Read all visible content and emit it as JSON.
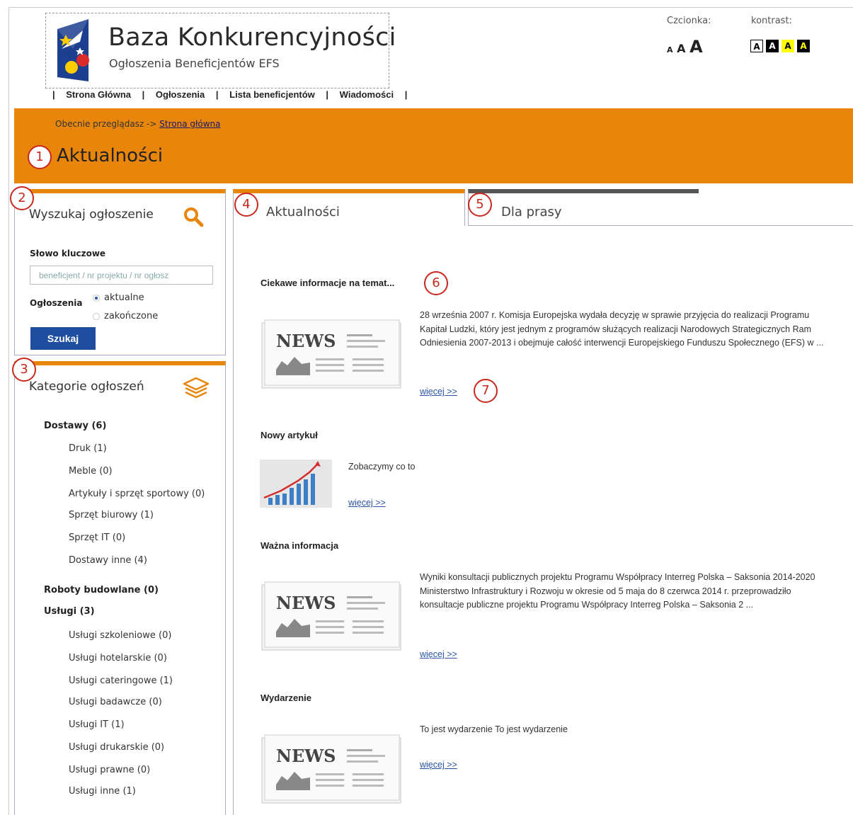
{
  "site": {
    "title": "Baza Konkurencyjności",
    "subtitle": "Ogłoszenia Beneficjentów EFS"
  },
  "top_nav": [
    "Strona Główna",
    "Ogłoszenia",
    "Lista beneficjentów",
    "Wiadomości"
  ],
  "accessibility": {
    "font_label": "Czcionka:",
    "font_sizes": [
      "A",
      "A",
      "A"
    ],
    "contrast_label": "kontrast:",
    "contrast_options": [
      "A",
      "A",
      "A",
      "A"
    ]
  },
  "breadcrumb": {
    "prefix": "Obecnie przeglądasz ->",
    "link": "Strona główna"
  },
  "page_title": "Aktualności",
  "search_panel": {
    "title": "Wyszukaj ogłoszenie",
    "keyword_label": "Słowo kluczowe",
    "keyword_placeholder": "beneficjent / nr projektu / nr ogłosz",
    "status_label": "Ogłoszenia",
    "status_options": [
      "aktualne",
      "zakończone"
    ],
    "selected_status": "aktualne",
    "button": "Szukaj"
  },
  "categories_panel": {
    "title": "Kategorie ogłoszeń",
    "groups": [
      {
        "name": "Dostawy (6)",
        "items": [
          "Druk (1)",
          "Meble (0)",
          "Artykuły i sprzęt sportowy (0)",
          "Sprzęt biurowy (1)",
          "Sprzęt IT (0)",
          "Dostawy inne (4)"
        ]
      },
      {
        "name": "Roboty budowlane (0)",
        "items": []
      },
      {
        "name": "Usługi (3)",
        "items": [
          "Usługi szkoleniowe (0)",
          "Usługi hotelarskie (0)",
          "Usługi cateringowe (1)",
          "Usługi badawcze (0)",
          "Usługi IT (1)",
          "Usługi drukarskie (0)",
          "Usługi prawne (0)",
          "Usługi inne (1)"
        ]
      }
    ]
  },
  "tabs": [
    "Aktualności",
    "Dla prasy"
  ],
  "news": [
    {
      "title": "Ciekawe informacje na temat...",
      "text": "28 września 2007 r. Komisja Europejska wydała decyzję w sprawie przyjęcia do realizacji Programu Kapitał Ludzki,  który jest jednym z programów służących realizacji Narodowych Strategicznych Ram Odniesienia 2007-2013 i obejmuje całość interwencji Europejskiego Funduszu Społecznego (EFS) w ...",
      "more": "więcej >>",
      "thumb": "newspaper"
    },
    {
      "title": "Nowy artykuł",
      "text": "Zobaczymy co to",
      "more": "więcej >>",
      "thumb": "growth-chart"
    },
    {
      "title": "Ważna informacja",
      "text": "Wyniki konsultacji publicznych projektu Programu Współpracy Interreg Polska – Saksonia 2014-2020   Ministerstwo Infrastruktury i Rozwoju w okresie od 5 maja do 8 czerwca 2014 r. przeprowadziło konsultacje publiczne projektu Programu Współpracy Interreg Polska – Saksonia 2 ...",
      "more": "więcej >>",
      "thumb": "newspaper"
    },
    {
      "title": "Wydarzenie",
      "text": "To jest wydarzenie To jest wydarzenie",
      "more": "więcej >>",
      "thumb": "newspaper"
    }
  ],
  "markers": [
    "1",
    "2",
    "3",
    "4",
    "5",
    "6",
    "7"
  ],
  "colors": {
    "accent": "#e8850b",
    "button": "#1f4ea1",
    "marker": "#c8281e",
    "link": "#2a55a5"
  }
}
